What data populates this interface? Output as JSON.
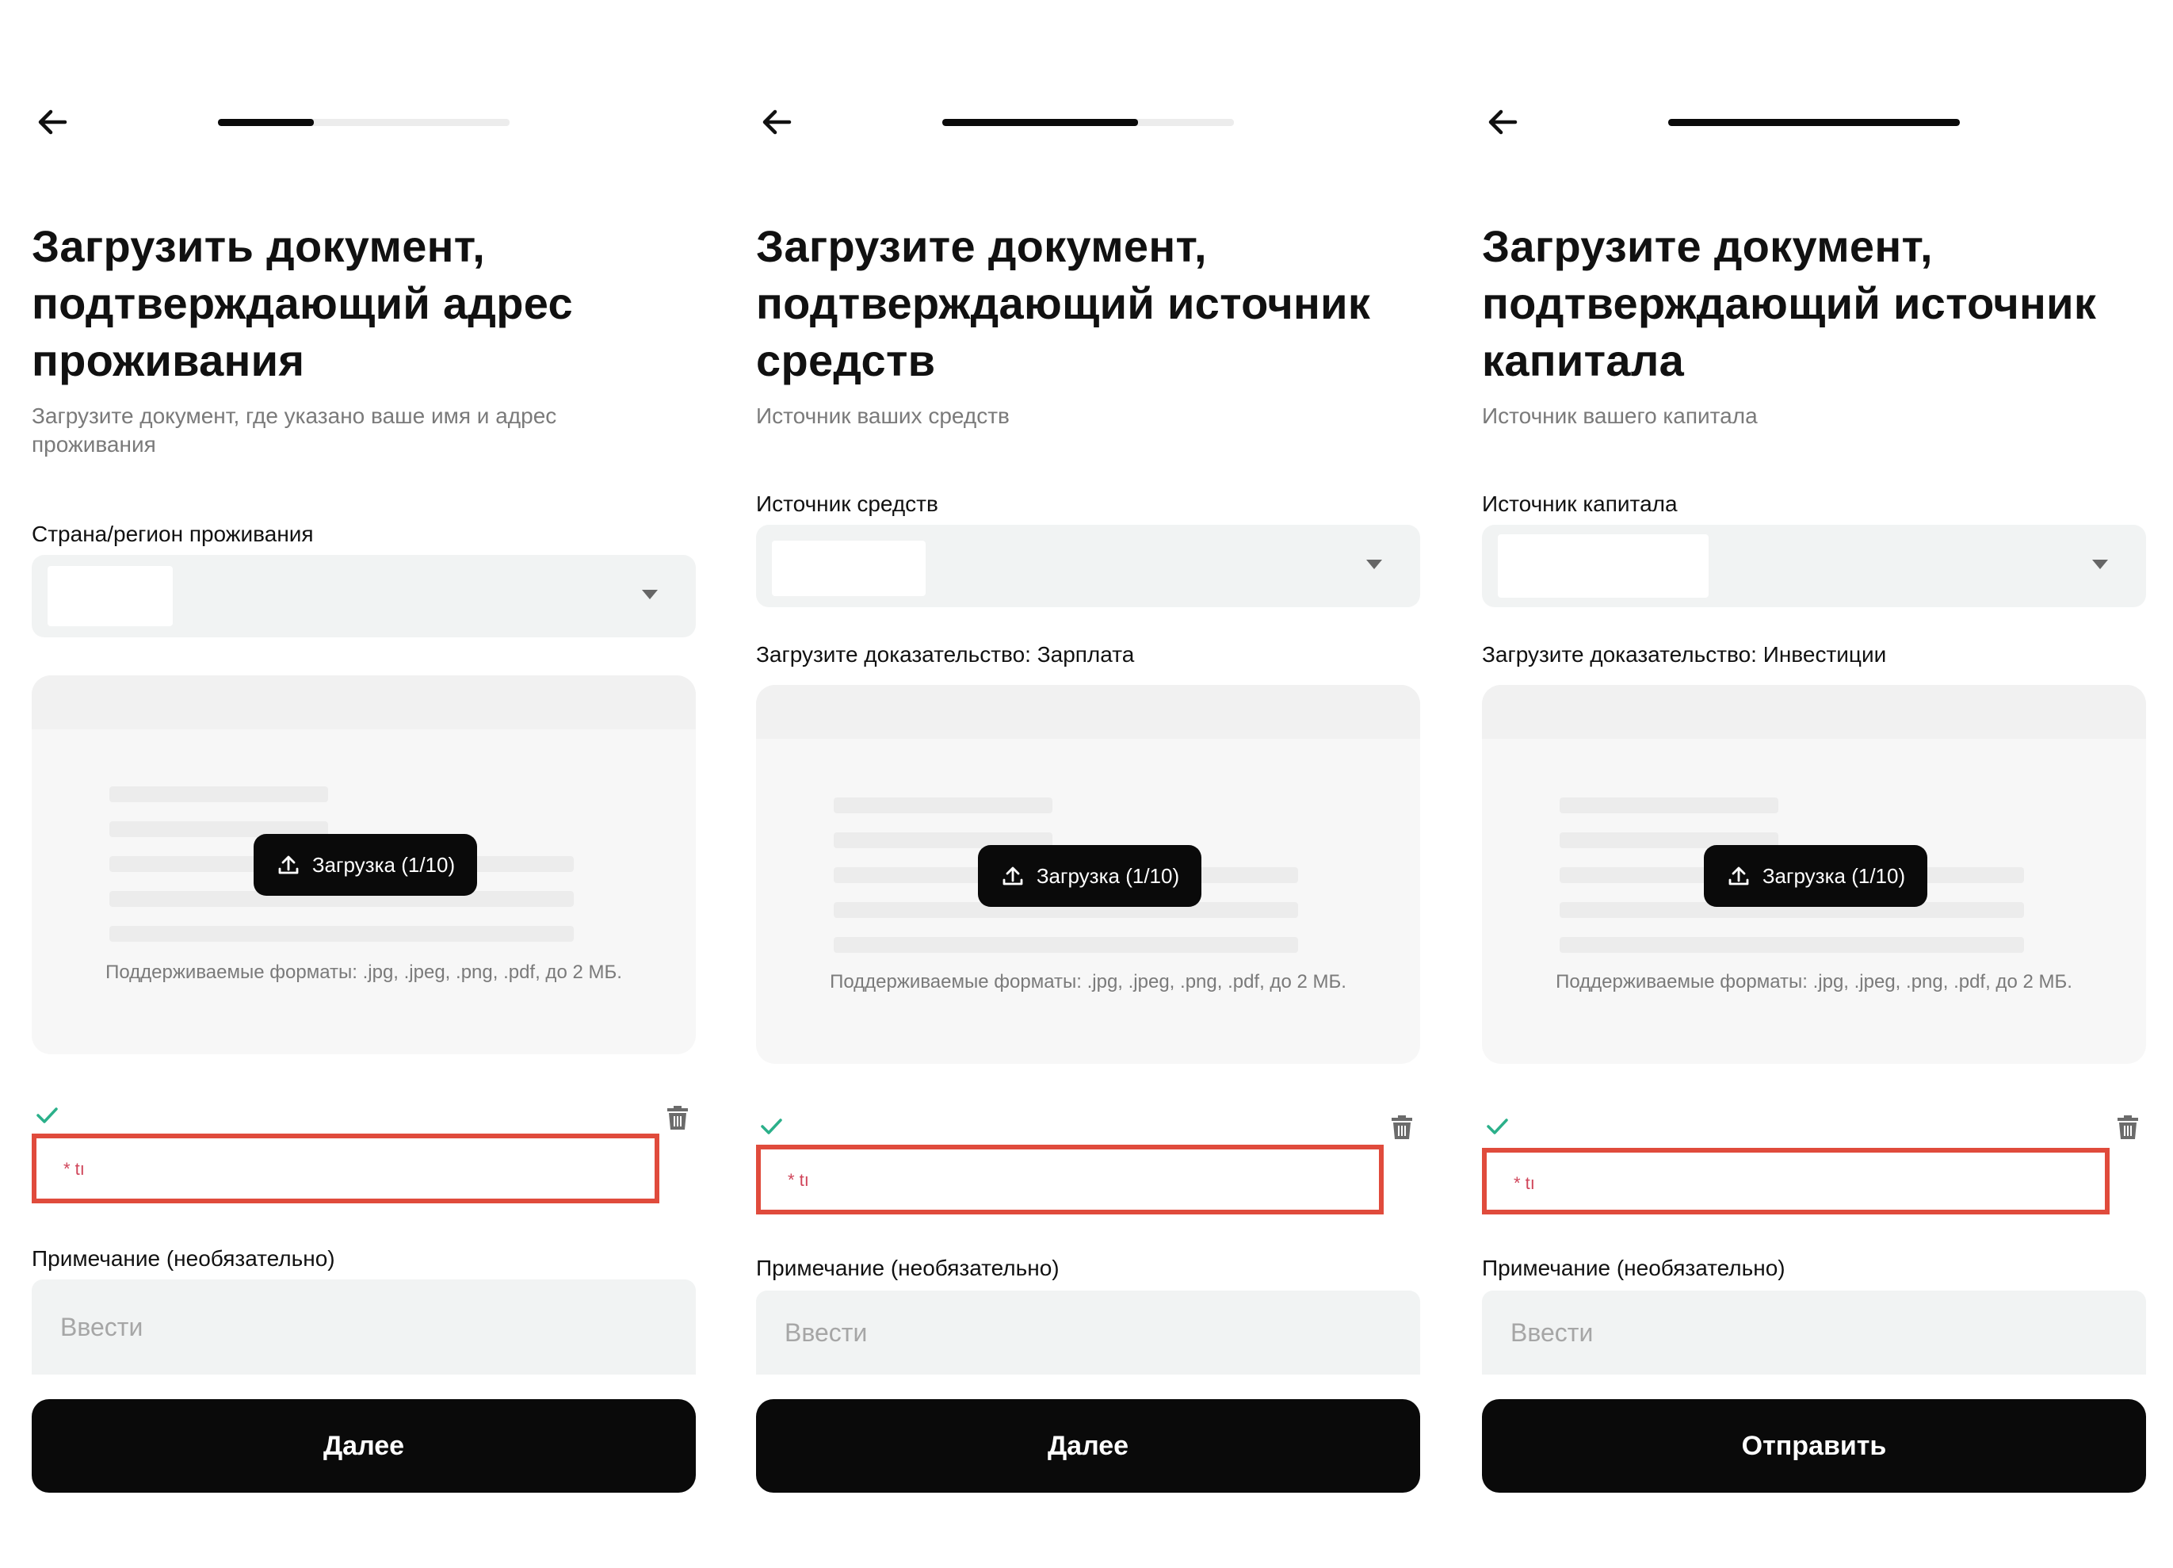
{
  "colors": {
    "accent": "#0a0a0a",
    "field_background": "#f1f3f3",
    "highlight_border": "#e04b3c",
    "check": "#2bb08a",
    "muted_text": "#7a7a7a"
  },
  "screens": [
    {
      "progress_fraction": 0.33,
      "title": "Загрузить документ, подтверждающий адрес проживания",
      "subtitle": "Загрузите документ, где указано ваше имя и адрес проживания",
      "select_label": "Страна/регион проживания",
      "proof_label": "",
      "upload_button": "Загрузка (1/10)",
      "formats": "Поддерживаемые форматы: .jpg, .jpeg, .png, .pdf, до 2 МБ.",
      "file_name": "* tı",
      "note_label": "Примечание (необязательно)",
      "note_placeholder": "Ввести",
      "primary_button": "Далее"
    },
    {
      "progress_fraction": 0.67,
      "title": "Загрузите документ, подтверждающий источник средств",
      "subtitle": "Источник ваших средств",
      "select_label": "Источник средств",
      "proof_label": "Загрузите доказательство: Зарплата",
      "upload_button": "Загрузка (1/10)",
      "formats": "Поддерживаемые форматы: .jpg, .jpeg, .png, .pdf, до 2 МБ.",
      "file_name": "* tı",
      "note_label": "Примечание (необязательно)",
      "note_placeholder": "Ввести",
      "primary_button": "Далее"
    },
    {
      "progress_fraction": 1.0,
      "title": "Загрузите документ, подтверждающий источник капитала",
      "subtitle": "Источник вашего капитала",
      "select_label": "Источник капитала",
      "proof_label": "Загрузите доказательство: Инвестиции",
      "upload_button": "Загрузка (1/10)",
      "formats": "Поддерживаемые форматы: .jpg, .jpeg, .png, .pdf, до 2 МБ.",
      "file_name": "* tı",
      "note_label": "Примечание (необязательно)",
      "note_placeholder": "Ввести",
      "primary_button": "Отправить"
    }
  ]
}
